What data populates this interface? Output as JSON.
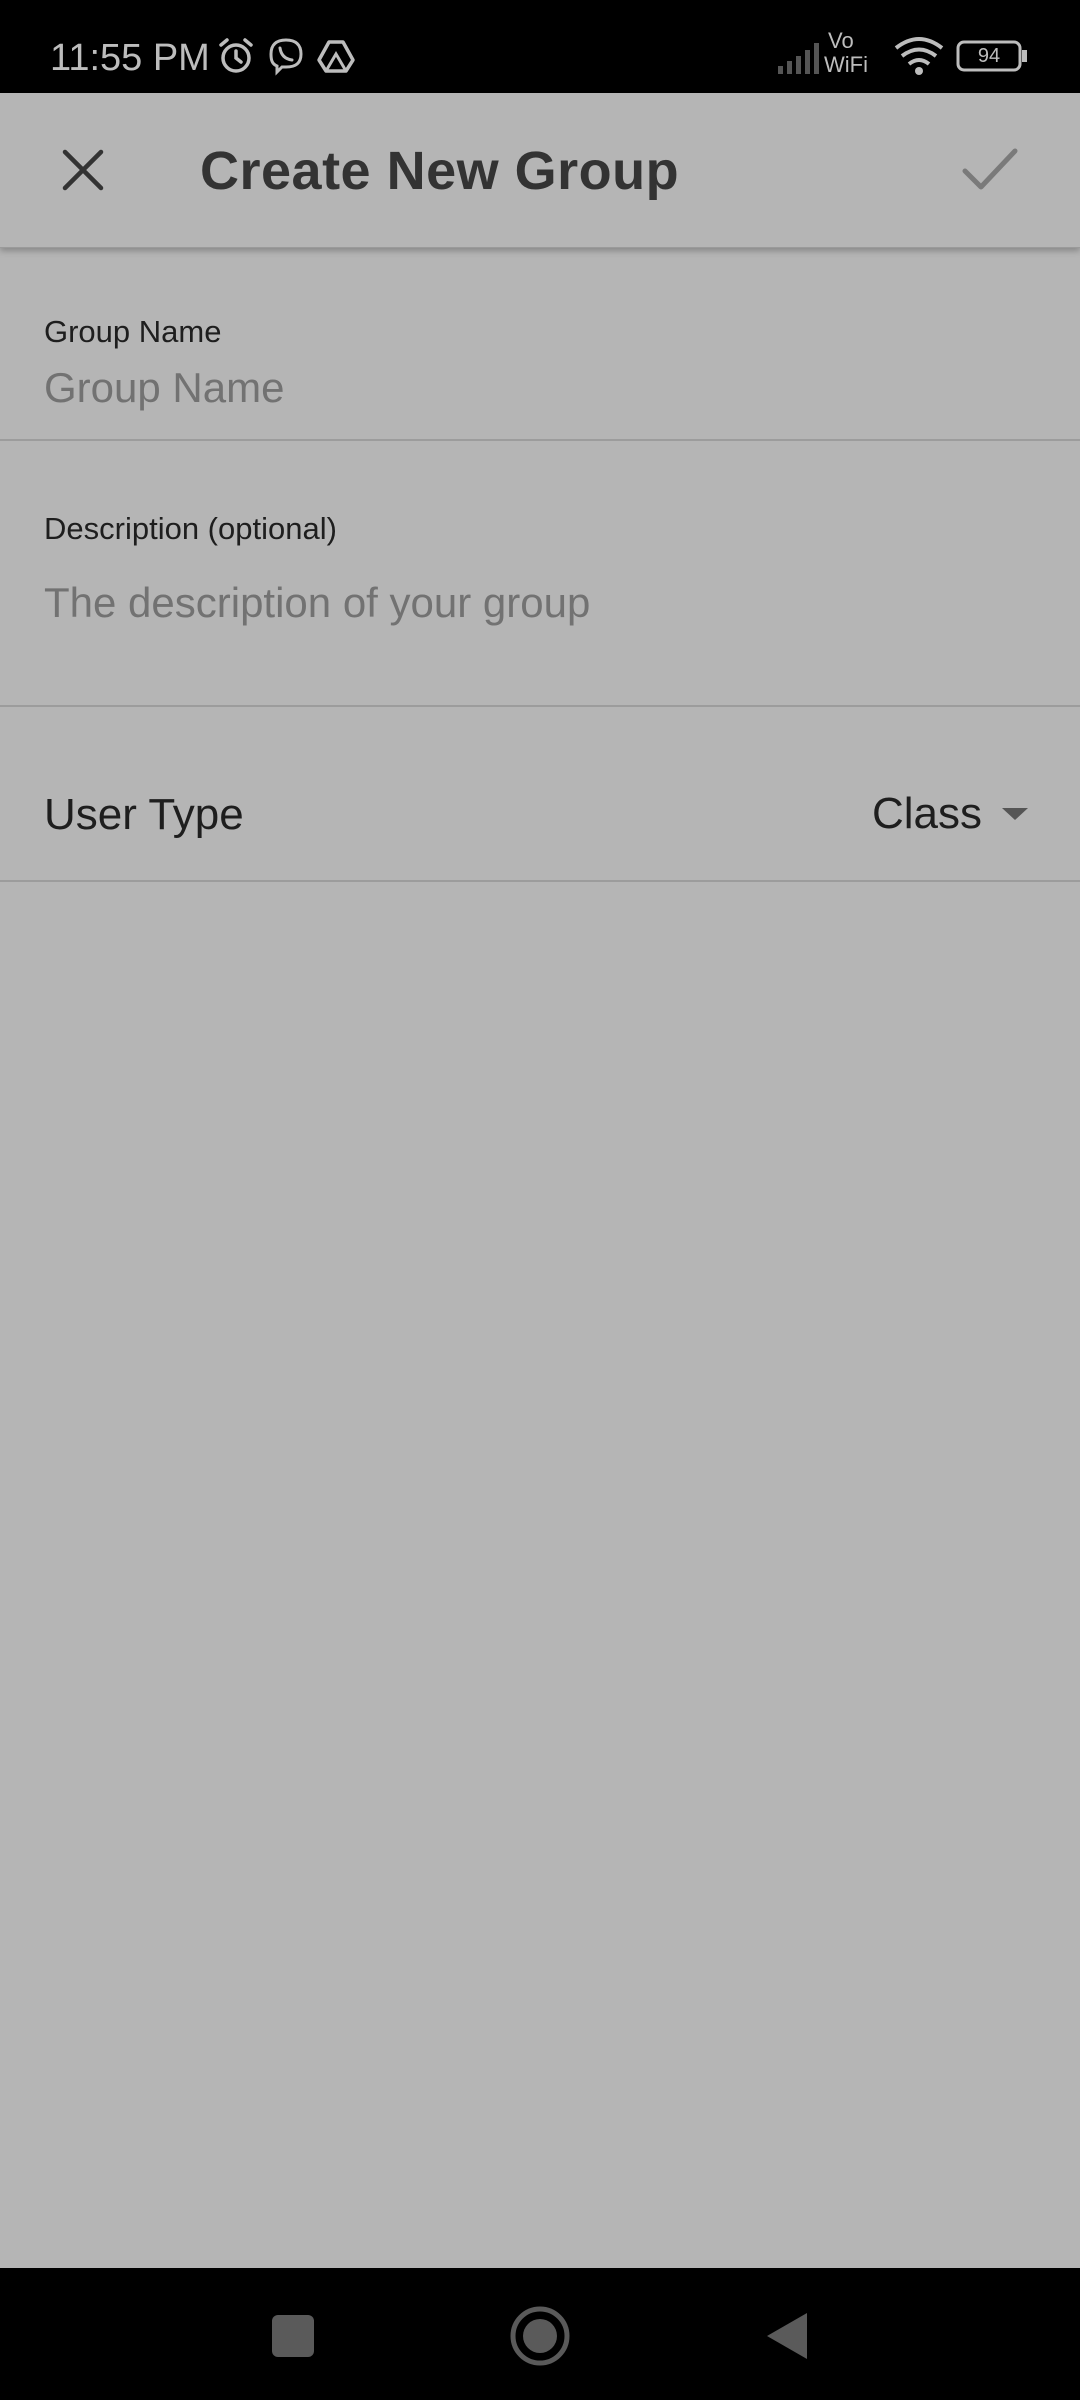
{
  "status_bar": {
    "time": "11:55 PM",
    "network_label_top": "Vo",
    "network_label_bottom": "WiFi",
    "battery": "94",
    "icons": [
      "alarm-icon",
      "viber-icon",
      "drive-icon",
      "signal-icon",
      "wifi-icon",
      "battery-icon"
    ]
  },
  "app_bar": {
    "title": "Create New Group",
    "close_icon": "close-icon",
    "confirm_icon": "check-icon"
  },
  "form": {
    "group_name": {
      "label": "Group Name",
      "value": "",
      "placeholder": "Group Name"
    },
    "description": {
      "label": "Description (optional)",
      "value": "",
      "placeholder": "The description of your group"
    },
    "user_type": {
      "label": "User Type",
      "selected": "Class"
    }
  },
  "nav_bar": {
    "buttons": [
      "recents-square-icon",
      "home-circle-icon",
      "back-triangle-icon"
    ]
  },
  "colors": {
    "background": "#b5b5b5",
    "bars": "#000000",
    "text": "#1e1e1e",
    "placeholder": "#727272"
  }
}
